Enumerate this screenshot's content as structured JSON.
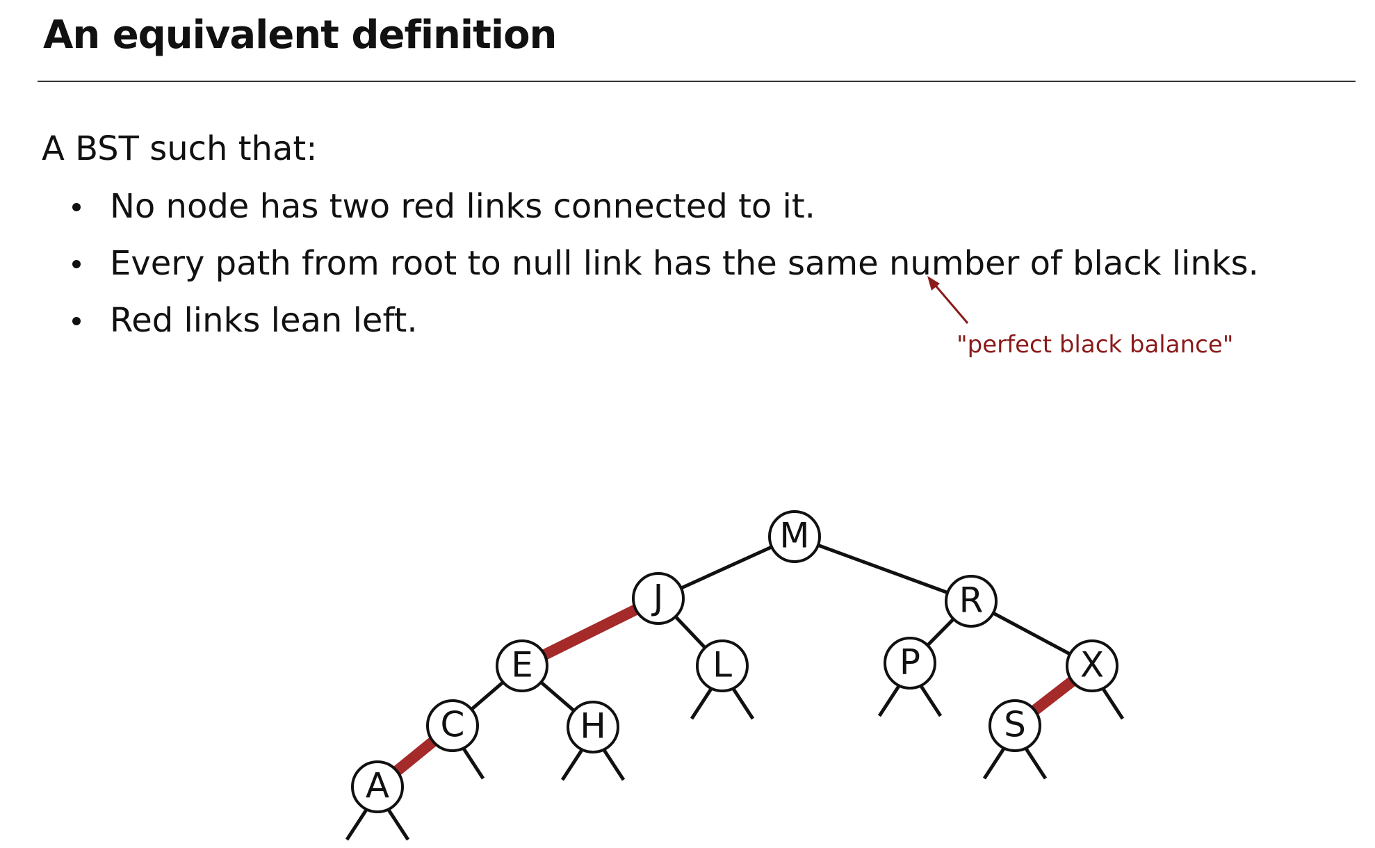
{
  "title": "An equivalent definition",
  "intro": "A BST such that:",
  "bullets": [
    "No node has two red links connected to it.",
    "Every path from root to null link has the same number of black links.",
    "Red links lean left."
  ],
  "annotation": "\"perfect black balance\"",
  "colors": {
    "red_link": "#a52a2a",
    "black_link": "#111111",
    "annotation": "#8b1a1a"
  },
  "tree": {
    "nodes": [
      {
        "key": "M"
      },
      {
        "key": "J"
      },
      {
        "key": "R"
      },
      {
        "key": "E"
      },
      {
        "key": "L"
      },
      {
        "key": "P"
      },
      {
        "key": "X"
      },
      {
        "key": "C"
      },
      {
        "key": "H"
      },
      {
        "key": "S"
      },
      {
        "key": "A"
      }
    ],
    "links": [
      {
        "from": "M",
        "to": "J",
        "color": "black"
      },
      {
        "from": "M",
        "to": "R",
        "color": "black"
      },
      {
        "from": "J",
        "to": "E",
        "color": "red"
      },
      {
        "from": "J",
        "to": "L",
        "color": "black"
      },
      {
        "from": "R",
        "to": "P",
        "color": "black"
      },
      {
        "from": "R",
        "to": "X",
        "color": "black"
      },
      {
        "from": "E",
        "to": "C",
        "color": "black"
      },
      {
        "from": "E",
        "to": "H",
        "color": "black"
      },
      {
        "from": "X",
        "to": "S",
        "color": "red"
      },
      {
        "from": "C",
        "to": "A",
        "color": "red"
      }
    ],
    "null_links": [
      {
        "node": "A",
        "side": "left"
      },
      {
        "node": "A",
        "side": "right"
      },
      {
        "node": "C",
        "side": "right"
      },
      {
        "node": "H",
        "side": "left"
      },
      {
        "node": "H",
        "side": "right"
      },
      {
        "node": "L",
        "side": "left"
      },
      {
        "node": "L",
        "side": "right"
      },
      {
        "node": "P",
        "side": "left"
      },
      {
        "node": "P",
        "side": "right"
      },
      {
        "node": "S",
        "side": "left"
      },
      {
        "node": "S",
        "side": "right"
      },
      {
        "node": "X",
        "side": "right"
      }
    ]
  }
}
